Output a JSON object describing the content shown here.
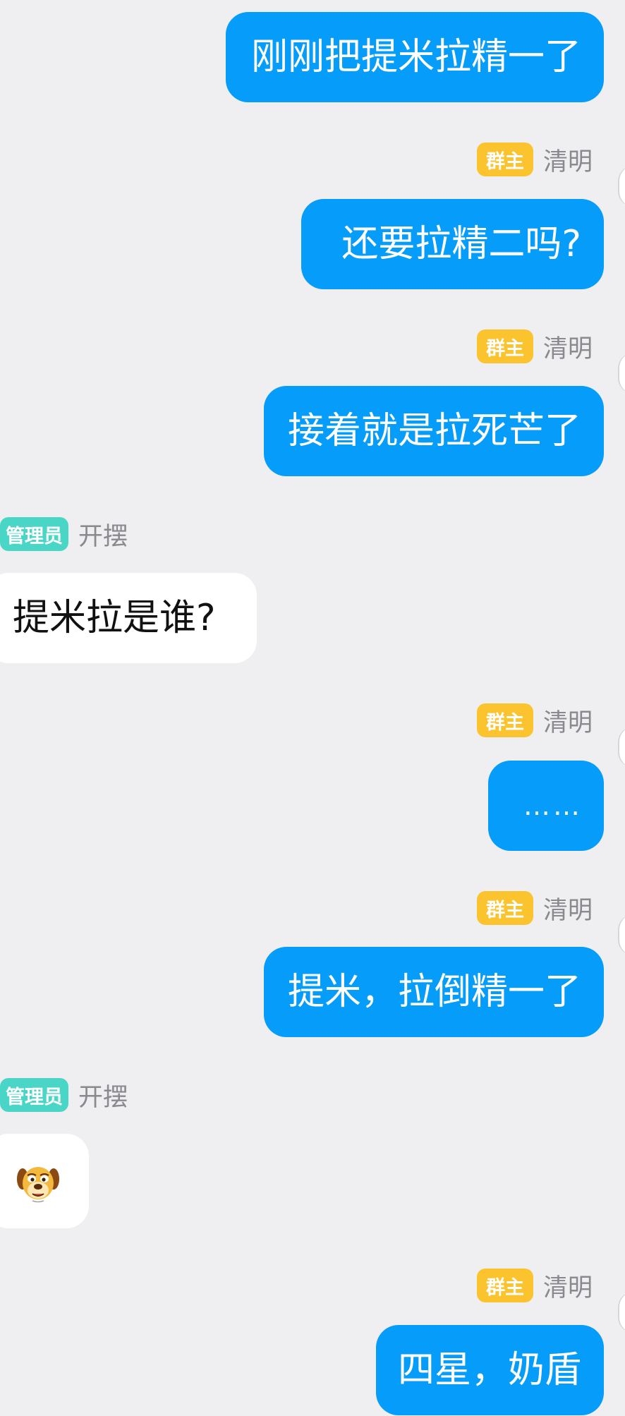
{
  "messages": [
    {
      "side": "self",
      "sender": "",
      "badge": "",
      "text": "刚刚把提米拉精一了"
    },
    {
      "side": "self",
      "sender": "清明",
      "badge": "群主",
      "text": "还要拉精二吗?"
    },
    {
      "side": "self",
      "sender": "清明",
      "badge": "群主",
      "text": "接着就是拉死芒了"
    },
    {
      "side": "other",
      "sender": "开摆",
      "badge": "管理员",
      "text": "提米拉是谁?"
    },
    {
      "side": "self",
      "sender": "清明",
      "badge": "群主",
      "text": "……"
    },
    {
      "side": "self",
      "sender": "清明",
      "badge": "群主",
      "text": "提米，拉倒精一了"
    },
    {
      "side": "other",
      "sender": "开摆",
      "badge": "管理员",
      "sticker": "dog-face-sticker"
    },
    {
      "side": "self",
      "sender": "清明",
      "badge": "群主",
      "text": "四星，奶盾"
    }
  ],
  "colors": {
    "background": "#efeff2",
    "self_bubble": "#069cf9",
    "other_bubble": "#ffffff",
    "owner_badge": "#fbc32d",
    "admin_badge": "#4ad6c6"
  }
}
